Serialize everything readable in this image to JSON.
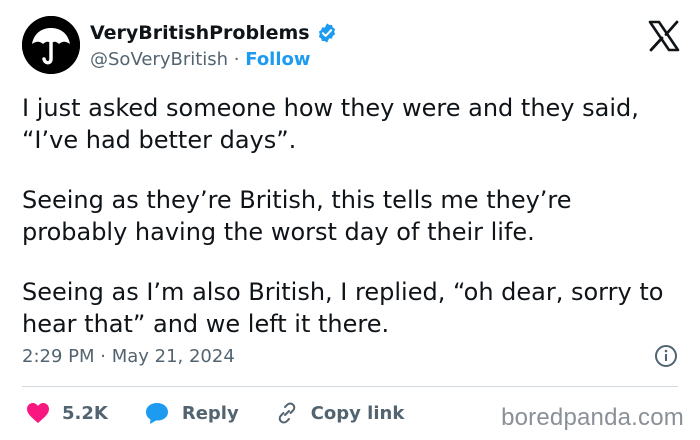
{
  "author": {
    "display_name": "VeryBritishProblems",
    "handle": "@SoVeryBritish",
    "separator": " · ",
    "follow_label": "Follow"
  },
  "tweet": {
    "paragraphs": [
      "I just asked someone how they were and they said, “I’ve had better days”.",
      "Seeing as they’re British, this tells me they’re probably having the worst day of their life.",
      "Seeing as I’m also British, I replied, “oh dear, sorry to hear that” and we left it there."
    ],
    "timestamp": "2:29 PM · May 21, 2024"
  },
  "actions": {
    "like_count": "5.2K",
    "reply_label": "Reply",
    "copy_link_label": "Copy link"
  },
  "watermark": "boredpanda.com",
  "colors": {
    "accent": "#1d9bf0",
    "like": "#f91880",
    "text": "#0f1419",
    "muted": "#536471"
  },
  "icons": [
    "umbrella-avatar-icon",
    "verified-badge-icon",
    "x-logo-icon",
    "info-icon",
    "heart-icon",
    "reply-bubble-icon",
    "link-icon"
  ]
}
